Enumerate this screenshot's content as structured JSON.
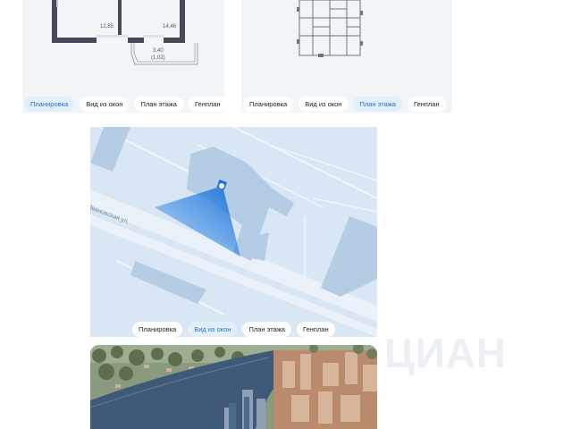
{
  "cards": {
    "plan": {
      "room_left_area": "12,85",
      "room_right_area": "14,46",
      "balcony_area": "3,40",
      "balcony_area_alt": "(1,02)",
      "tabs": [
        "Планировка",
        "Вид из окон",
        "План этажа",
        "Генплан"
      ],
      "active_tab": 0
    },
    "floor": {
      "tabs": [
        "Планировка",
        "Вид из окон",
        "План этажа",
        "Генплан"
      ],
      "active_tab": 2
    },
    "window_view": {
      "street_label": "Ивановская ул.",
      "tabs": [
        "Планировка",
        "Вид из окон",
        "План этажа",
        "Генплан"
      ],
      "active_tab": 1
    },
    "aerial": {}
  },
  "watermark": "ЦИАН",
  "colors": {
    "accent": "#1f71d6",
    "active_tab_bg": "#e3eefb",
    "map_bg": "#d9e6f3",
    "map_building": "#b5cde4",
    "wall": "#444b57"
  }
}
